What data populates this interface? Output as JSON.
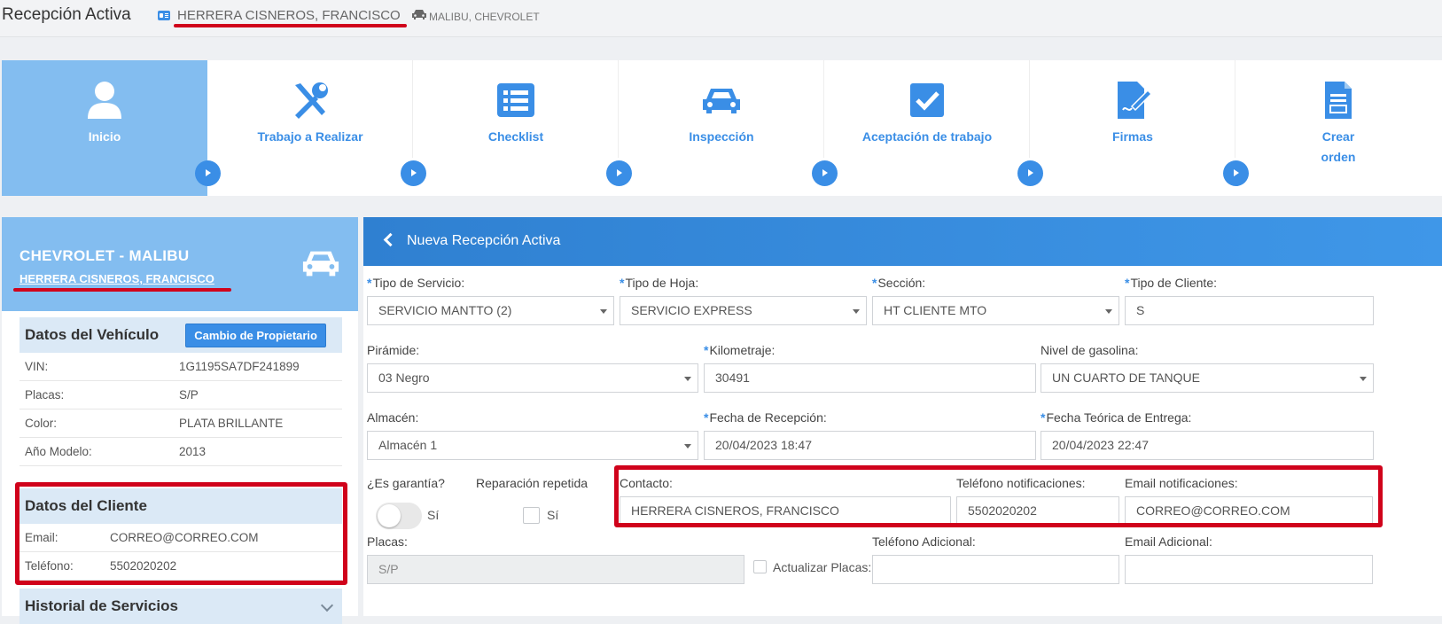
{
  "header": {
    "title": "Recepción Activa",
    "client_name": "HERRERA CISNEROS, FRANCISCO",
    "vehicle": "MALIBU, CHEVROLET",
    "icons": [
      "client-card-icon",
      "car-icon"
    ]
  },
  "steps": [
    {
      "label": "Inicio",
      "icon": "user-icon"
    },
    {
      "label": "Trabajo a Realizar",
      "icon": "tools-icon"
    },
    {
      "label": "Checklist",
      "icon": "list-icon"
    },
    {
      "label": "Inspección",
      "icon": "car-icon"
    },
    {
      "label": "Aceptación de trabajo",
      "icon": "check-icon"
    },
    {
      "label": "Firmas",
      "icon": "signature-icon"
    },
    {
      "label_line1": "Crear",
      "label_line2": "orden",
      "icon": "document-icon"
    }
  ],
  "left": {
    "make_model": "CHEVROLET - MALIBU",
    "owner": "HERRERA CISNEROS, FRANCISCO",
    "vehicle_section": {
      "title": "Datos del Vehículo",
      "button": "Cambio de Propietario",
      "rows": [
        {
          "k": "VIN:",
          "v": "1G1195SA7DF241899"
        },
        {
          "k": "Placas:",
          "v": "S/P"
        },
        {
          "k": "Color:",
          "v": "PLATA BRILLANTE"
        },
        {
          "k": "Año Modelo:",
          "v": "2013"
        }
      ]
    },
    "client_section": {
      "title": "Datos del Cliente",
      "rows": [
        {
          "k": "Email:",
          "v": "CORREO@CORREO.COM"
        },
        {
          "k": "Teléfono:",
          "v": "5502020202"
        }
      ]
    },
    "history_title": "Historial de Servicios"
  },
  "form": {
    "title": "Nueva Recepción Activa",
    "tipo_servicio": {
      "label": "Tipo de Servicio:",
      "value": "SERVICIO MANTTO (2)"
    },
    "tipo_hoja": {
      "label": "Tipo de Hoja:",
      "value": "SERVICIO EXPRESS"
    },
    "seccion": {
      "label": "Sección:",
      "value": "HT CLIENTE MTO"
    },
    "tipo_cliente": {
      "label": "Tipo de Cliente:",
      "value": "S"
    },
    "piramide": {
      "label": "Pirámide:",
      "value": "03 Negro"
    },
    "kilometraje": {
      "label": "Kilometraje:",
      "value": "30491"
    },
    "gasolina": {
      "label": "Nivel de gasolina:",
      "value": "UN CUARTO DE TANQUE"
    },
    "almacen": {
      "label": "Almacén:",
      "value": "Almacén 1"
    },
    "fecha_recepcion": {
      "label": "Fecha de Recepción:",
      "value": "20/04/2023 18:47"
    },
    "fecha_entrega": {
      "label": "Fecha Teórica de Entrega:",
      "value": "20/04/2023 22:47"
    },
    "garantia": {
      "label": "¿Es garantía?",
      "option": "Sí"
    },
    "reparacion": {
      "label": "Reparación repetida",
      "option": "Sí"
    },
    "contacto": {
      "label": "Contacto:",
      "value": "HERRERA CISNEROS, FRANCISCO"
    },
    "tel_notif": {
      "label": "Teléfono notificaciones:",
      "value": "5502020202"
    },
    "email_notif": {
      "label": "Email notificaciones:",
      "value": "CORREO@CORREO.COM"
    },
    "placas": {
      "label": "Placas:",
      "value": "S/P"
    },
    "actualizar_placas": "Actualizar Placas:",
    "tel_adicional": {
      "label": "Teléfono Adicional:",
      "value": ""
    },
    "email_adicional": {
      "label": "Email Adicional:",
      "value": ""
    }
  },
  "colors": {
    "accent": "#3a8ee6",
    "active_step": "#83bdf0",
    "highlight": "#d0021b"
  }
}
